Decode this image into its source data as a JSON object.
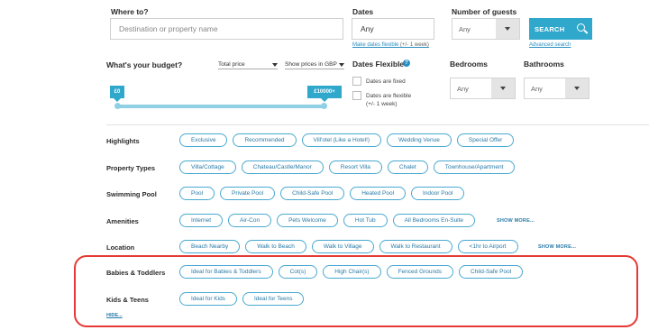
{
  "where": {
    "label": "Where to?",
    "placeholder": "Destination or property name"
  },
  "dates": {
    "label": "Dates",
    "value": "Any",
    "flexible_link": "Make dates flexible",
    "flexible_note": "(+/- 1 week)"
  },
  "guests": {
    "label": "Number of guests",
    "value": "Any"
  },
  "search": {
    "label": "SEARCH",
    "advanced_link": "Advanced search"
  },
  "budget": {
    "label": "What's your budget?",
    "price_type": "Total price",
    "currency_select": "Show prices in GBP",
    "min_tag": "£0",
    "max_tag": "£10000+",
    "range_fraction": [
      0.0,
      1.0
    ]
  },
  "dates_flexible": {
    "label": "Dates Flexible?",
    "info_glyph": "?",
    "option_fixed": "Dates are fixed",
    "option_flexible_line1": "Dates are flexible",
    "option_flexible_line2": "(+/- 1 week)"
  },
  "bedrooms": {
    "label": "Bedrooms",
    "value": "Any"
  },
  "bathrooms": {
    "label": "Bathrooms",
    "value": "Any"
  },
  "filters": {
    "highlights": {
      "label": "Highlights",
      "chips": [
        "Exclusive",
        "Recommended",
        "Vill'otel (Like a Hotel!)",
        "Wedding Venue",
        "Special Offer"
      ]
    },
    "property_types": {
      "label": "Property Types",
      "chips": [
        "Villa/Cottage",
        "Chateau/Castle/Manor",
        "Resort Villa",
        "Chalet",
        "Townhouse/Apartment"
      ]
    },
    "swimming_pool": {
      "label": "Swimming Pool",
      "chips": [
        "Pool",
        "Private Pool",
        "Child-Safe Pool",
        "Heated Pool",
        "Indoor Pool"
      ]
    },
    "amenities": {
      "label": "Amenities",
      "chips": [
        "Internet",
        "Air-Con",
        "Pets Welcome",
        "Hot Tub",
        "All Bedrooms En-Suite"
      ],
      "show_more": "SHOW MORE..."
    },
    "location": {
      "label": "Location",
      "chips": [
        "Beach Nearby",
        "Walk to Beach",
        "Walk to Village",
        "Walk to Restaurant",
        "<1hr to Airport"
      ],
      "show_more": "SHOW MORE..."
    },
    "babies_toddlers": {
      "label": "Babies & Toddlers",
      "chips": [
        "Ideal for Babies & Toddlers",
        "Cot(s)",
        "High Chair(s)",
        "Fenced Grounds",
        "Child-Safe Pool"
      ]
    },
    "kids_teens": {
      "label": "Kids & Teens",
      "chips": [
        "Ideal for Kids",
        "Ideal for Teens"
      ]
    }
  },
  "hide_link": "HIDE...",
  "colors": {
    "accent": "#2fa8cc",
    "chip_border": "#49a9d0",
    "highlight_box": "#e53935"
  }
}
